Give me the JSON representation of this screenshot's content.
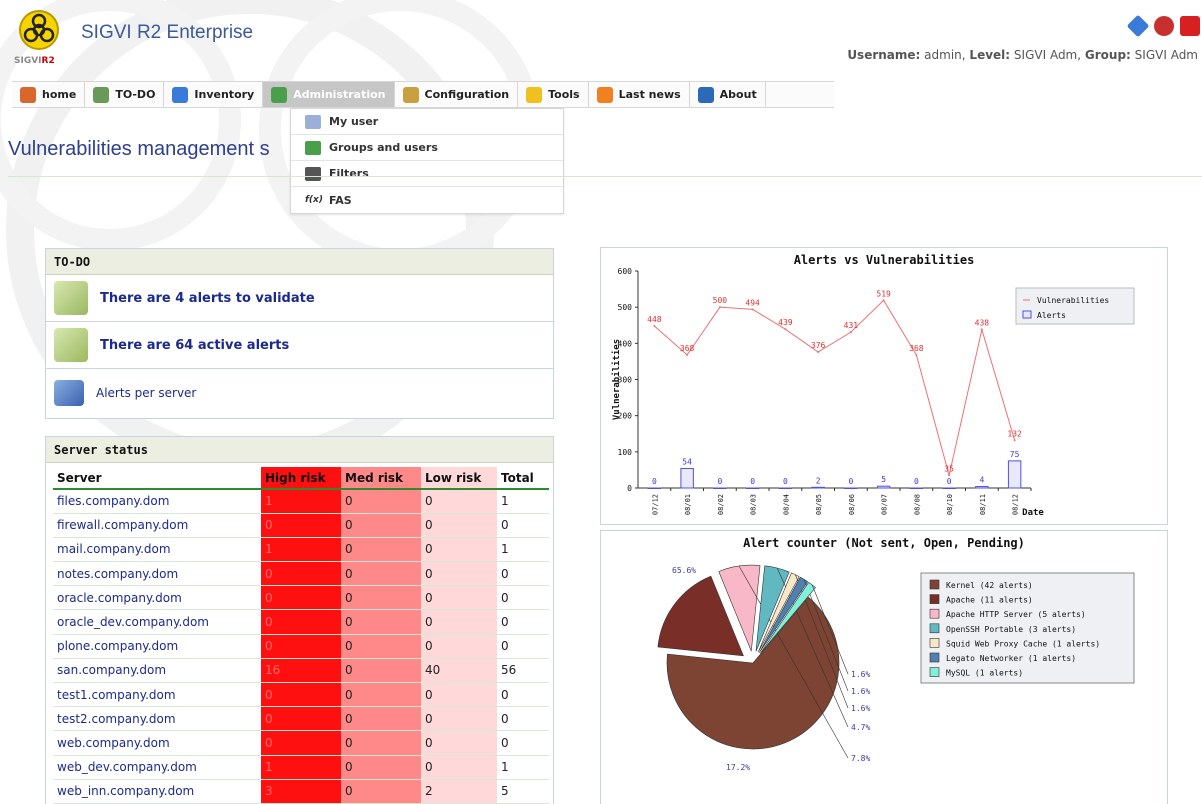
{
  "app": {
    "logo_text_a": "SIGVI",
    "logo_text_b": "R2",
    "title": "SIGVI R2 Enterprise",
    "user_label": "Username:",
    "user_value": "admin,",
    "level_label": "Level:",
    "level_value": "SIGVI Adm,",
    "group_label": "Group:",
    "group_value": "SIGVI Adm"
  },
  "menu": [
    {
      "label": "home",
      "icon": "home-icon",
      "color": "#d9662a"
    },
    {
      "label": "TO-DO",
      "icon": "todo-icon",
      "color": "#6a9a5a"
    },
    {
      "label": "Inventory",
      "icon": "inventory-icon",
      "color": "#3a7ad8"
    },
    {
      "label": "Administration",
      "icon": "administration-icon",
      "color": "#4aa04a"
    },
    {
      "label": "Configuration",
      "icon": "configuration-icon",
      "color": "#c8a040"
    },
    {
      "label": "Tools",
      "icon": "tools-icon",
      "color": "#f0c020"
    },
    {
      "label": "Last news",
      "icon": "rss-icon",
      "color": "#f08020"
    },
    {
      "label": "About",
      "icon": "about-icon",
      "color": "#2a6ab8"
    }
  ],
  "dropdown": [
    {
      "label": "My user",
      "icon": "my-user-icon"
    },
    {
      "label": "Groups and users",
      "icon": "groups-icon"
    },
    {
      "label": "Filters",
      "icon": "filter-icon"
    },
    {
      "label": "FAS",
      "icon": "function-icon",
      "glyph": "f(x)"
    }
  ],
  "page_title": "Vulnerabilities management s",
  "todo": {
    "title": "TO-DO",
    "items": [
      {
        "label": "There are 4 alerts to validate"
      },
      {
        "label": "There are 64 active alerts"
      },
      {
        "label": "Alerts per server"
      }
    ]
  },
  "server_status": {
    "title": "Server status",
    "columns": [
      "Server",
      "High risk",
      "Med risk",
      "Low risk",
      "Total"
    ],
    "rows": [
      [
        "files.company.dom",
        "1",
        "0",
        "0",
        "1"
      ],
      [
        "firewall.company.dom",
        "0",
        "0",
        "0",
        "0"
      ],
      [
        "mail.company.dom",
        "1",
        "0",
        "0",
        "1"
      ],
      [
        "notes.company.dom",
        "0",
        "0",
        "0",
        "0"
      ],
      [
        "oracle.company.dom",
        "0",
        "0",
        "0",
        "0"
      ],
      [
        "oracle_dev.company.dom",
        "0",
        "0",
        "0",
        "0"
      ],
      [
        "plone.company.dom",
        "0",
        "0",
        "0",
        "0"
      ],
      [
        "san.company.dom",
        "16",
        "0",
        "40",
        "56"
      ],
      [
        "test1.company.dom",
        "0",
        "0",
        "0",
        "0"
      ],
      [
        "test2.company.dom",
        "0",
        "0",
        "0",
        "0"
      ],
      [
        "web.company.dom",
        "0",
        "0",
        "0",
        "0"
      ],
      [
        "web_dev.company.dom",
        "1",
        "0",
        "0",
        "1"
      ],
      [
        "web_inn.company.dom",
        "3",
        "0",
        "2",
        "5"
      ]
    ]
  },
  "chart_data": [
    {
      "type": "line",
      "title": "Alerts vs Vulnerabilities",
      "ylabel": "Vulnerabilities",
      "xlabel": "Date",
      "ylim": [
        0,
        600
      ],
      "yticks": [
        "0",
        "100",
        "200",
        "300",
        "400",
        "500",
        "600"
      ],
      "categories": [
        "07/12",
        "08/01",
        "08/02",
        "08/03",
        "08/04",
        "08/05",
        "08/06",
        "08/07",
        "08/08",
        "08/10",
        "08/11",
        "08/12"
      ],
      "series": [
        {
          "name": "Vulnerabilities",
          "kind": "line",
          "color": "#f07070",
          "values": [
            448,
            368,
            500,
            494,
            439,
            376,
            431,
            519,
            368,
            35,
            438,
            132
          ],
          "labels": [
            "448",
            "368",
            "500",
            "494",
            "439",
            "376",
            "431",
            "519",
            "368",
            "35",
            "438",
            "132"
          ]
        },
        {
          "name": "Alerts",
          "kind": "bar",
          "color": "#2020d0",
          "values": [
            0,
            54,
            0,
            0,
            0,
            2,
            0,
            5,
            0,
            0,
            4,
            75
          ],
          "labels": [
            "0",
            "54",
            "0",
            "0",
            "0",
            "2",
            "0",
            "5",
            "0",
            "0",
            "4",
            "75"
          ]
        }
      ],
      "legend": "top-right"
    },
    {
      "type": "pie",
      "title": "Alert counter (Not sent, Open, Pending)",
      "slices": [
        {
          "name": "Kernel (42 alerts)",
          "value": 65.6,
          "label": "65.6%",
          "color": "#7d4333"
        },
        {
          "name": "Apache (11 alerts)",
          "value": 17.2,
          "label": "17.2%",
          "color": "#7a2e28"
        },
        {
          "name": "Apache HTTP Server (5 alerts)",
          "value": 7.8,
          "label": "7.8%",
          "color": "#f8b8c8"
        },
        {
          "name": "OpenSSH Portable (3 alerts)",
          "value": 4.7,
          "label": "4.7%",
          "color": "#60b8c0"
        },
        {
          "name": "Squid Web Proxy Cache (1 alerts)",
          "value": 1.6,
          "label": "1.6%",
          "color": "#f8e8c8"
        },
        {
          "name": "Legato Networker (1 alerts)",
          "value": 1.6,
          "label": "1.6%",
          "color": "#5080b0"
        },
        {
          "name": "MySQL (1 alerts)",
          "value": 1.6,
          "label": "1.6%",
          "color": "#80f0d8"
        }
      ],
      "legend": "right"
    }
  ]
}
